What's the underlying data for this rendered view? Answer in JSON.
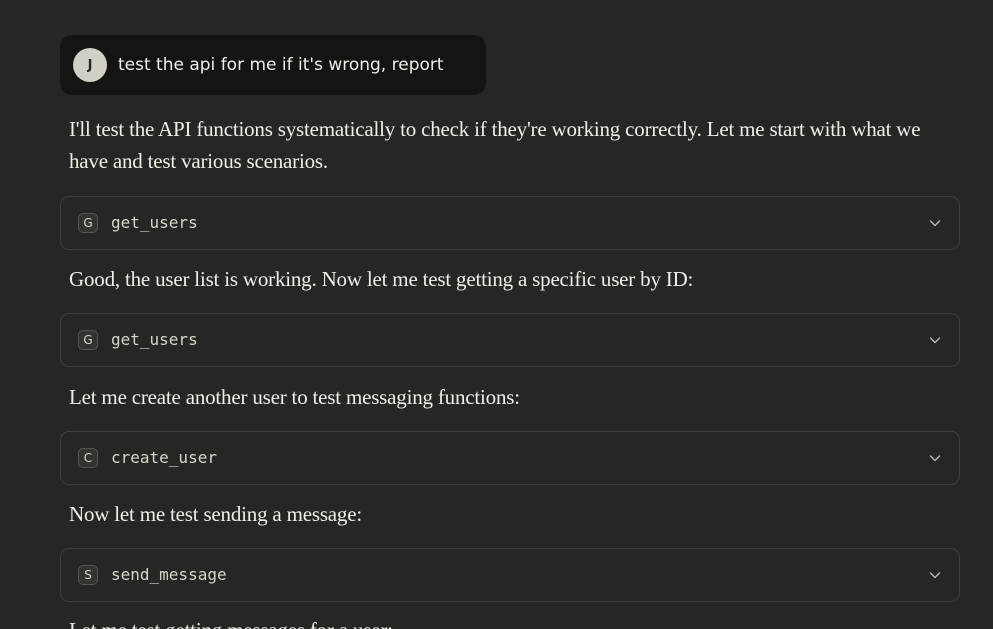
{
  "user_message": {
    "avatar_initial": "J",
    "text": "test the api for me if it's wrong, report"
  },
  "assistant": {
    "para1": "I'll test the API functions systematically to check if they're working correctly. Let me start with what we have and test various scenarios.",
    "tool1": {
      "badge": "G",
      "name": "get_users",
      "icon": "chevron-down-icon"
    },
    "para2": "Good, the user list is working. Now let me test getting a specific user by ID:",
    "tool2": {
      "badge": "G",
      "name": "get_users",
      "icon": "chevron-down-icon"
    },
    "para3": "Let me create another user to test messaging functions:",
    "tool3": {
      "badge": "C",
      "name": "create_user",
      "icon": "chevron-down-icon"
    },
    "para4": "Now let me test sending a message:",
    "tool4": {
      "badge": "S",
      "name": "send_message",
      "icon": "chevron-down-icon"
    },
    "para5": "Let me test getting messages for a user:"
  },
  "colors": {
    "background": "#262624",
    "user_bubble": "#141413",
    "text": "#f0eee6",
    "tool_border": "#3e3e3a"
  }
}
